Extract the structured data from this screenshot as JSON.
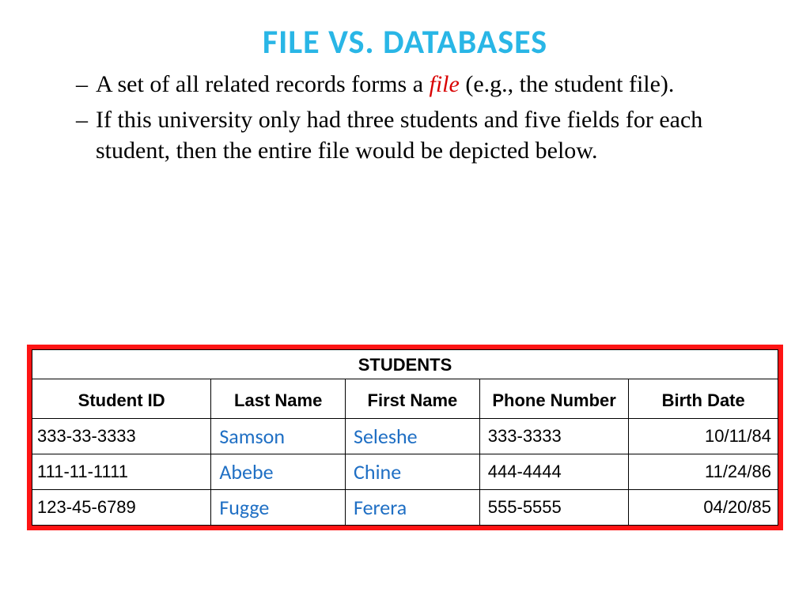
{
  "title": "FILE VS. DATABASES",
  "bullets": [
    {
      "pre": "A set of all related records forms a ",
      "keyword": "file",
      "post": " (e.g., the student file)."
    },
    {
      "pre": "If this university only had three students and five fields for each student, then the entire file would be depicted below.",
      "keyword": "",
      "post": ""
    }
  ],
  "table": {
    "caption": "STUDENTS",
    "headers": [
      "Student ID",
      "Last Name",
      "First Name",
      "Phone Number",
      "Birth Date"
    ],
    "rows": [
      {
        "id": "333-33-3333",
        "last": "Samson",
        "first": "Seleshe",
        "phone": "333-3333",
        "bdate": "10/11/84"
      },
      {
        "id": "111-11-1111",
        "last": "Abebe",
        "first": "Chine",
        "phone": "444-4444",
        "bdate": "11/24/86"
      },
      {
        "id": "123-45-6789",
        "last": "Fugge",
        "first": "Ferera",
        "phone": "555-5555",
        "bdate": "04/20/85"
      }
    ]
  }
}
